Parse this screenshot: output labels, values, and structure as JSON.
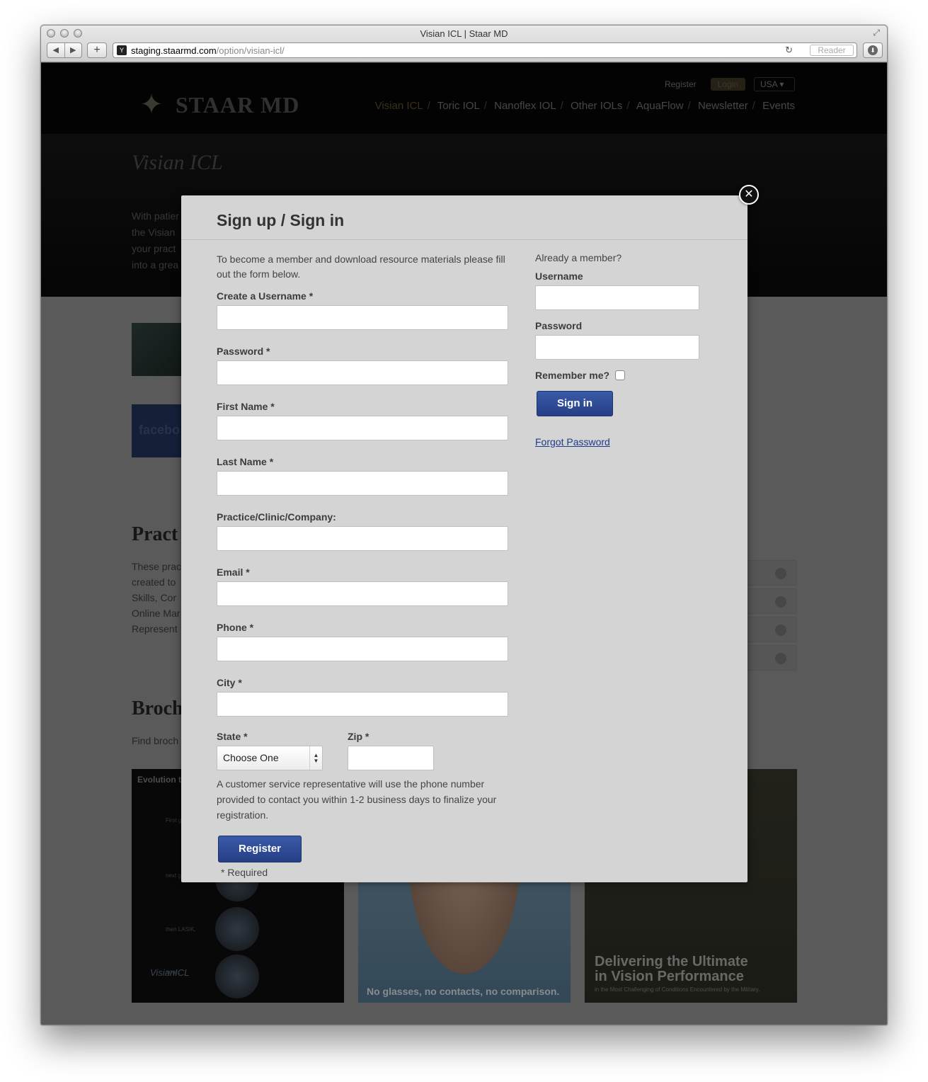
{
  "browser": {
    "title": "Visian ICL | Staar MD",
    "url_host": "staging.staarmd.com",
    "url_path": "/option/visian-icl/",
    "reader_label": "Reader",
    "add_label": "+",
    "back_label": "◀",
    "forward_label": "▶"
  },
  "site": {
    "logo_text": "STAAR MD",
    "top_links": {
      "register": "Register",
      "login": "Login",
      "country": "USA"
    },
    "nav": [
      "Visian ICL",
      "Toric IOL",
      "Nanoflex IOL",
      "Other IOLs",
      "AquaFlow",
      "Newsletter",
      "Events"
    ],
    "nav_active_index": 0,
    "page_heading": "Visian ICL",
    "intro_lines": [
      "With patier",
      "the Visian",
      "your pract",
      "into a grea"
    ],
    "facebook_text": "facebo",
    "practice_heading": "Pract",
    "practice_lines": [
      "These prac",
      "created to",
      "Skills, Cor",
      "Online Mar",
      "Represent"
    ],
    "brochures_heading": "Broch",
    "brochures_text": "Find broch",
    "brochure1": {
      "title": "Evolution t",
      "lines": [
        "First g",
        "next g",
        "then LASIK,",
        "now..."
      ],
      "logo": "VisianICL"
    },
    "brochure2": {
      "caption": "No glasses, no contacts, no comparison."
    },
    "brochure3": {
      "caption_line1": "Delivering the Ultimate",
      "caption_line2": "in Vision Performance",
      "sub": "in the Most Challenging of Conditions Encountered by the Military."
    },
    "colors": {
      "modal_bg": "#d4d4d4",
      "button_blue": "#2f4c98",
      "link_blue": "#1c3b8a"
    }
  },
  "modal": {
    "title": "Sign up / Sign in",
    "close_icon": "close-icon",
    "register": {
      "intro": "To become a member and download resource materials please fill out the form below.",
      "fields": {
        "username": "Create a Username *",
        "password": "Password *",
        "first_name": "First Name *",
        "last_name": "Last Name *",
        "company": "Practice/Clinic/Company:",
        "email": "Email *",
        "phone": "Phone *",
        "city": "City *",
        "state": "State *",
        "zip": "Zip *"
      },
      "state_selected": "Choose One",
      "notice": "A customer service representative will use the phone number provided to contact you within 1-2 business days to finalize your registration.",
      "register_button": "Register",
      "required_note": "* Required"
    },
    "login": {
      "already": "Already a member?",
      "username_label": "Username",
      "password_label": "Password",
      "remember_label": "Remember me?",
      "signin_button": "Sign in",
      "forgot_link": "Forgot Password"
    }
  }
}
